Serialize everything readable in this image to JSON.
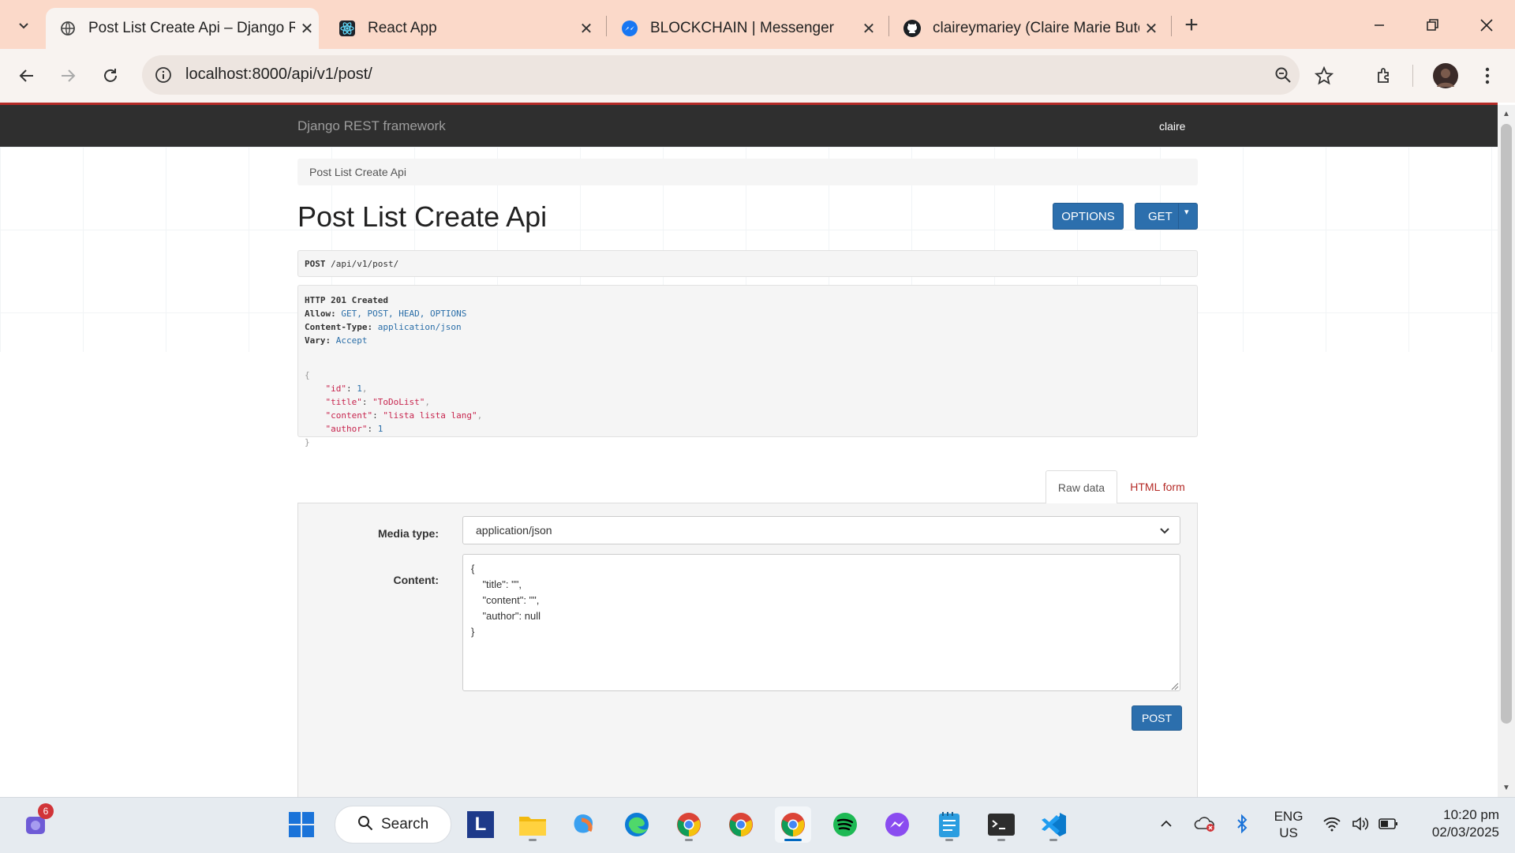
{
  "browser": {
    "tabs": [
      {
        "title": "Post List Create Api – Django REST framework",
        "icon": "globe-icon",
        "active": true
      },
      {
        "title": "React App",
        "icon": "react-icon",
        "active": false
      },
      {
        "title": "BLOCKCHAIN | Messenger",
        "icon": "messenger-icon",
        "active": false
      },
      {
        "title": "claireymariey (Claire Marie Butor)",
        "icon": "github-icon",
        "active": false
      }
    ],
    "url": "localhost:8000/api/v1/post/"
  },
  "navbar": {
    "brand": "Django REST framework",
    "user": "claire"
  },
  "breadcrumb": "Post List Create Api",
  "page_title": "Post List Create Api",
  "buttons": {
    "options": "OPTIONS",
    "get": "GET",
    "post": "POST"
  },
  "request_line": {
    "method": "POST",
    "path": "/api/v1/post/"
  },
  "response": {
    "status": "HTTP 201 Created",
    "allow_label": "Allow:",
    "allow_value": "GET, POST, HEAD, OPTIONS",
    "content_type_label": "Content-Type:",
    "content_type_value": "application/json",
    "vary_label": "Vary:",
    "vary_value": "Accept",
    "body": {
      "id": "1",
      "title": "\"ToDoList\"",
      "content": "\"lista lista lang\"",
      "author": "1"
    }
  },
  "form": {
    "tabs": [
      "Raw data",
      "HTML form"
    ],
    "active_tab": "Raw data",
    "media_type_label": "Media type:",
    "media_type_value": "application/json",
    "content_label": "Content:",
    "content_value": "{\n    \"title\": \"\",\n    \"content\": \"\",\n    \"author\": null\n}"
  },
  "taskbar": {
    "notification_count": "6",
    "search": "Search",
    "lang_line1": "ENG",
    "lang_line2": "US",
    "time": "10:20 pm",
    "date": "02/03/2025"
  },
  "colors": {
    "tabbar": "#fbd9c9",
    "navbar": "#2f2f2f",
    "accent_red": "#b52b27",
    "button_blue": "#2c6fad"
  }
}
